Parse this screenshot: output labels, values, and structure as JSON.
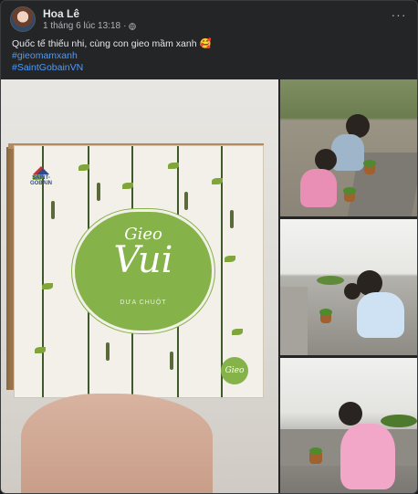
{
  "post": {
    "author": "Hoa Lê",
    "timestamp": "1 tháng 6 lúc 13:18",
    "separator": "·",
    "privacy_icon": "globe-icon",
    "more_label": "···",
    "caption": "Quốc tế thiếu nhi, cùng con gieo mầm xanh 🥰",
    "hashtags": [
      "#gieomamxanh",
      "#SaintGobainVN"
    ]
  },
  "photos": {
    "main": {
      "brand_text": "SAINT-GOBAIN",
      "logo_small": "Gieo",
      "logo_big": "Vui",
      "logo_sub": "DƯA CHUỘT",
      "badge": "Gieo"
    }
  },
  "colors": {
    "background": "#242526",
    "text": "#e4e6eb",
    "muted": "#b0b3b8",
    "link": "#4b9bff",
    "logo_green": "#86b24a"
  }
}
